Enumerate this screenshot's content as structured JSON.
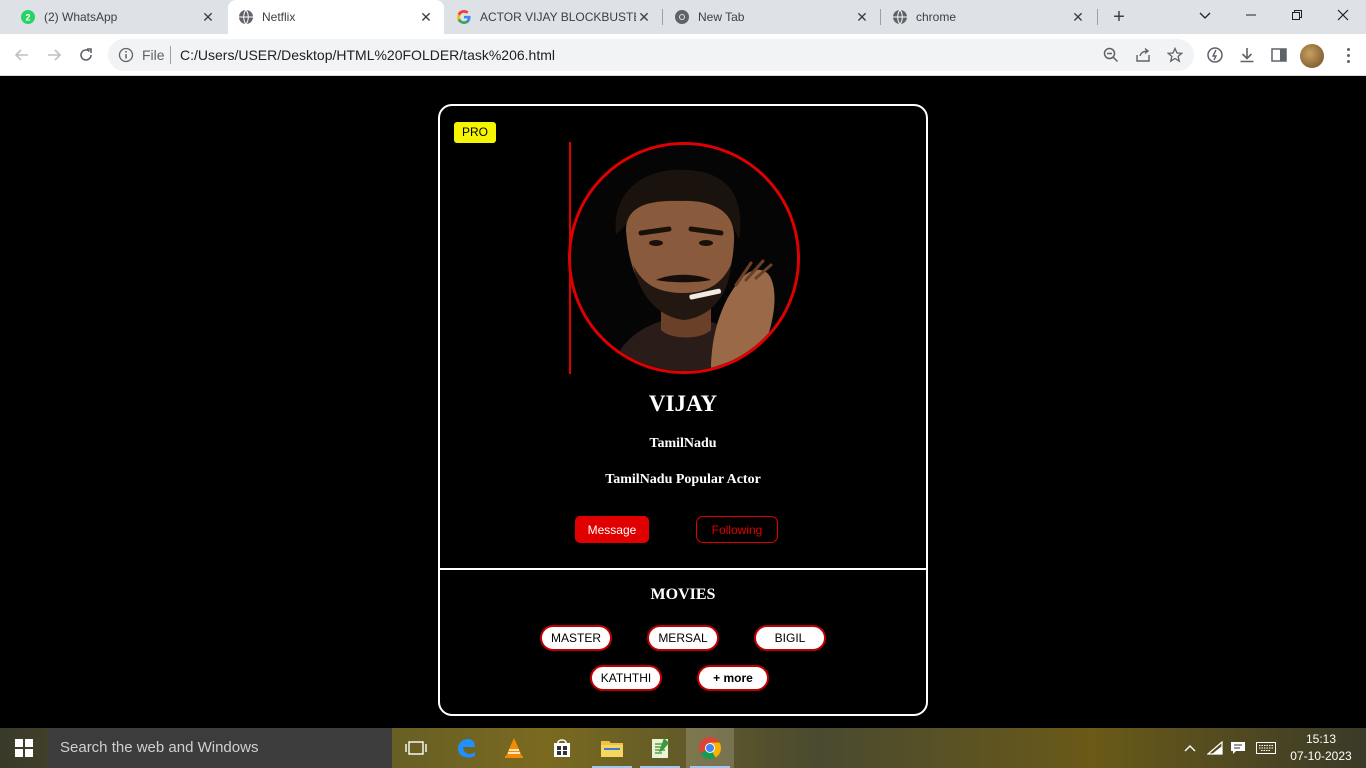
{
  "browser": {
    "tabs": [
      {
        "title": "(2) WhatsApp",
        "icon": "whatsapp-icon"
      },
      {
        "title": "Netflix",
        "icon": "globe-icon"
      },
      {
        "title": "ACTOR VIJAY BLOCKBUSTER",
        "icon": "google-icon"
      },
      {
        "title": "New Tab",
        "icon": "chrome-icon"
      },
      {
        "title": "chrome",
        "icon": "globe-icon"
      }
    ],
    "active_tab": 1,
    "address": {
      "scheme_label": "File",
      "url": "C:/Users/USER/Desktop/HTML%20FOLDER/task%206.html"
    }
  },
  "profile": {
    "badge": "PRO",
    "name": "VIJAY",
    "location": "TamilNadu",
    "description": "TamilNadu Popular Actor",
    "message_label": "Message",
    "following_label": "Following"
  },
  "movies": {
    "heading": "MOVIES",
    "items": [
      "MASTER",
      "MERSAL",
      "BIGIL",
      "KATHTHI",
      "+ more"
    ]
  },
  "taskbar": {
    "search_placeholder": "Search the web and Windows",
    "time": "15:13",
    "date": "07-10-2023"
  },
  "colors": {
    "accent_red": "#e00000",
    "badge_yellow": "#f5f500",
    "page_bg": "#000000"
  }
}
